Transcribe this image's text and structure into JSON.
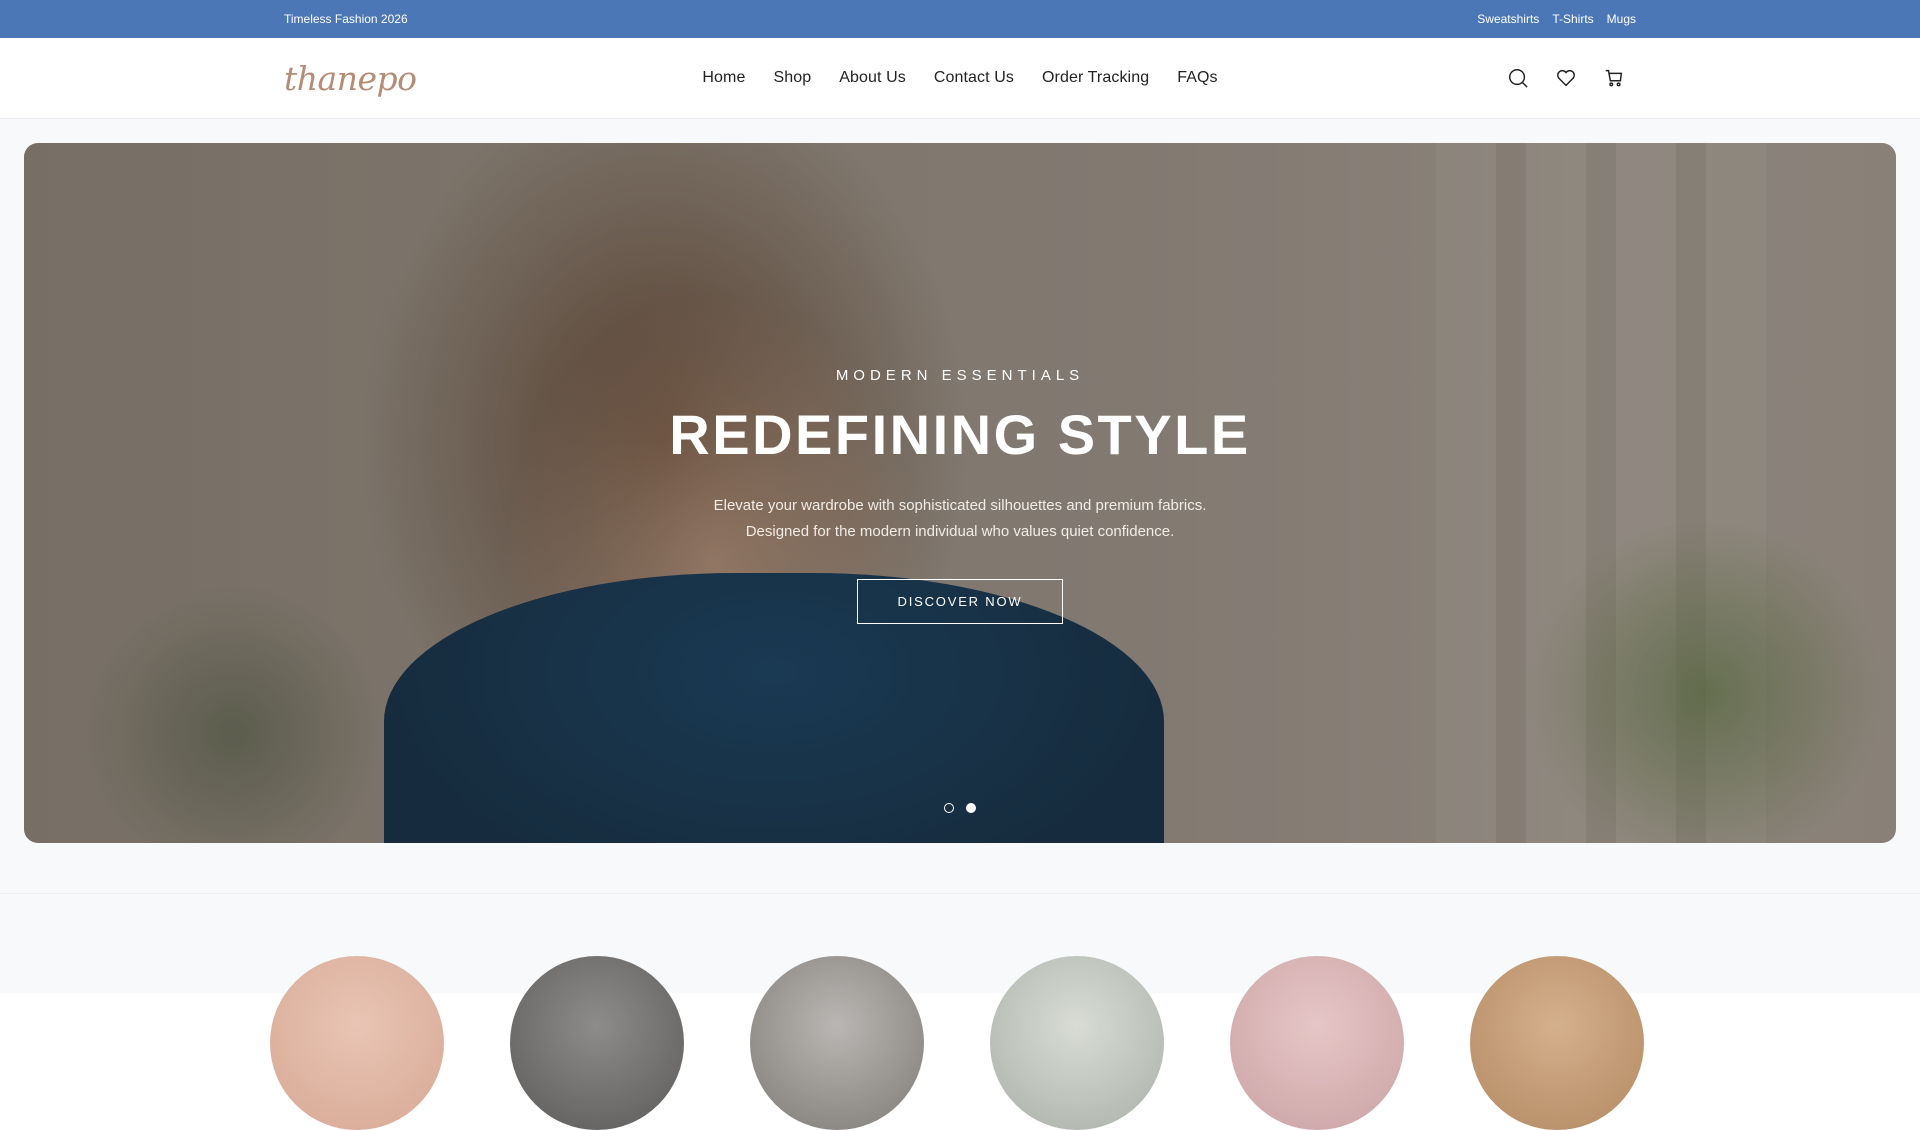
{
  "topbar": {
    "announcement": "Timeless Fashion 2026",
    "links": [
      "Sweatshirts",
      "T-Shirts",
      "Mugs"
    ]
  },
  "header": {
    "logo": "thanepo",
    "nav": [
      "Home",
      "Shop",
      "About Us",
      "Contact Us",
      "Order Tracking",
      "FAQs"
    ],
    "icons": [
      "search-icon",
      "heart-icon",
      "cart-icon"
    ]
  },
  "hero": {
    "eyebrow": "MODERN ESSENTIALS",
    "title": "REDEFINING STYLE",
    "subtitle_line1": "Elevate your wardrobe with sophisticated silhouettes and premium fabrics.",
    "subtitle_line2": "Designed for the modern individual who values quiet confidence.",
    "cta": "DISCOVER NOW",
    "slides": 2,
    "active_slide": 2
  },
  "categories": {
    "count": 6
  },
  "colors": {
    "topbar": "#4b77b6",
    "logo": "#b58d76",
    "page_bg": "#f8f9fb"
  }
}
